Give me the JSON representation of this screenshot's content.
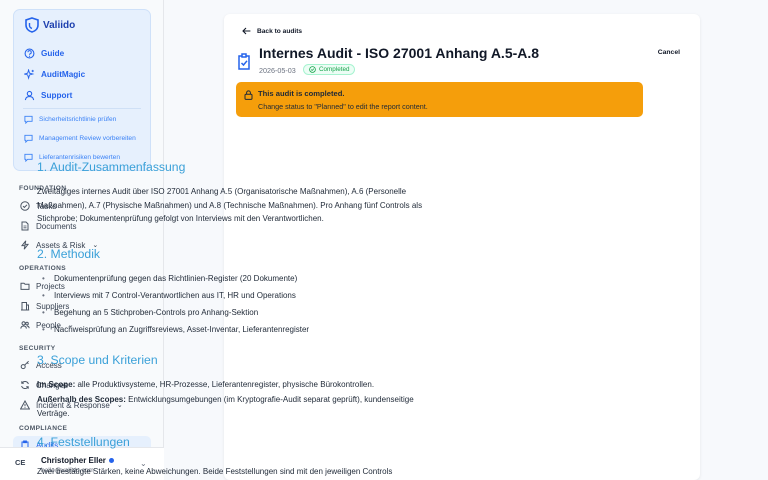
{
  "sidebar": {
    "brand": "Valiido",
    "card_nav": [
      "Guide",
      "AuditMagic",
      "Support"
    ],
    "suggestions": [
      "Sicherheitsrichtlinie prüfen",
      "Management Review vorbereiten",
      "Lieferantenrisiken bewerten"
    ],
    "sections": {
      "foundation": "FOUNDATION",
      "operations": "OPERATIONS",
      "security": "SECURITY",
      "compliance": "COMPLIANCE"
    },
    "items": {
      "tasks": "Tasks",
      "documents": "Documents",
      "assets": "Assets & Risk",
      "projects": "Projects",
      "suppliers": "Suppliers",
      "people": "People",
      "access": "Access",
      "changes": "Changes",
      "incident": "Incident & Response",
      "audits": "Audits"
    },
    "user": {
      "initials": "CE",
      "name": "Christopher Eller",
      "email": "hallo@valiido.com"
    }
  },
  "header": {
    "back": "Back to audits",
    "cancel": "Cancel",
    "title": "Internes Audit - ISO 27001 Anhang A.5-A.8",
    "date": "2026-05-03",
    "status": "Completed"
  },
  "alert": {
    "title": "This audit is completed.",
    "text": "Change status to \"Planned\" to edit the report content."
  },
  "report": {
    "s1_title": "1. Audit-Zusammenfassung",
    "s1_text": "Zweitägiges internes Audit über ISO 27001 Anhang A.5 (Organisatorische Maßnahmen), A.6 (Personelle Maßnahmen), A.7 (Physische Maßnahmen) und A.8 (Technische Maßnahmen). Pro Anhang fünf Controls als Stichprobe; Dokumentenprüfung gefolgt von Interviews mit den Verantwortlichen.",
    "s2_title": "2. Methodik",
    "s2_items": [
      "Dokumentenprüfung gegen das Richtlinien-Register (20 Dokumente)",
      "Interviews mit 7 Control-Verantwortlichen aus IT, HR und Operations",
      "Begehung an 5 Stichproben-Controls pro Anhang-Sektion",
      "Nachweisprüfung an Zugriffsreviews, Asset-Inventar, Lieferantenregister"
    ],
    "s3_title": "3. Scope und Kriterien",
    "s3_in_label": "Im Scope:",
    "s3_in_text": " alle Produktivsysteme, HR-Prozesse, Lieferantenregister, physische Bürokontrollen.",
    "s3_out_label": "Außerhalb des Scopes:",
    "s3_out_text": " Entwicklungsumgebungen (im Kryptografie-Audit separat geprüft), kundenseitige Verträge.",
    "s4_title": "4. Feststellungen",
    "s4_text": "Zwei bestätigte Stärken, keine Abweichungen. Beide Feststellungen sind mit den jeweiligen Controls"
  }
}
